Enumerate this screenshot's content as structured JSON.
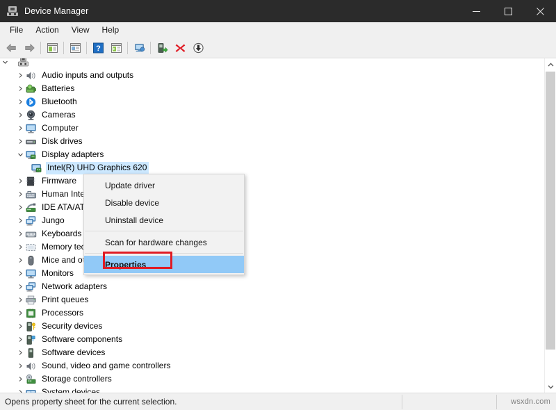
{
  "window": {
    "title": "Device Manager",
    "icon": "device-manager-icon",
    "controls": {
      "minimize": "minimize-icon",
      "maximize": "maximize-icon",
      "close": "close-icon"
    }
  },
  "menubar": {
    "items": [
      {
        "label": "File"
      },
      {
        "label": "Action"
      },
      {
        "label": "View"
      },
      {
        "label": "Help"
      }
    ]
  },
  "toolbar": {
    "buttons": [
      {
        "name": "back-icon",
        "tip": "Back"
      },
      {
        "name": "forward-icon",
        "tip": "Forward"
      },
      {
        "name": "show-hide-console-tree-icon",
        "tip": "Show/Hide Console Tree"
      },
      {
        "name": "properties-icon",
        "tip": "Properties"
      },
      {
        "name": "help-icon",
        "tip": "Help"
      },
      {
        "name": "update-driver-icon",
        "tip": "Update driver"
      },
      {
        "name": "scan-for-hardware-changes-icon",
        "tip": "Scan for hardware changes"
      },
      {
        "name": "enable-device-icon",
        "tip": "Enable device"
      },
      {
        "name": "uninstall-device-icon",
        "tip": "Uninstall device"
      },
      {
        "name": "disable-device-icon",
        "tip": "Disable device"
      }
    ]
  },
  "tree": {
    "root": {
      "label": "",
      "icon": "computer-root-icon",
      "expanded": true
    },
    "items": [
      {
        "label": "Audio inputs and outputs",
        "icon": "speaker-icon",
        "expanded": false,
        "indent": 1
      },
      {
        "label": "Batteries",
        "icon": "battery-icon",
        "expanded": false,
        "indent": 1
      },
      {
        "label": "Bluetooth",
        "icon": "bluetooth-icon",
        "expanded": false,
        "indent": 1
      },
      {
        "label": "Cameras",
        "icon": "camera-icon",
        "expanded": false,
        "indent": 1
      },
      {
        "label": "Computer",
        "icon": "monitor-icon",
        "expanded": false,
        "indent": 1
      },
      {
        "label": "Disk drives",
        "icon": "disk-drive-icon",
        "expanded": false,
        "indent": 1
      },
      {
        "label": "Display adapters",
        "icon": "display-adapter-icon",
        "expanded": true,
        "indent": 1
      },
      {
        "label": "Intel(R) UHD Graphics 620",
        "icon": "display-adapter-icon",
        "expanded": null,
        "indent": 2,
        "selected": true
      },
      {
        "label": "Firmware",
        "icon": "firmware-icon",
        "expanded": false,
        "indent": 1
      },
      {
        "label": "Human Interface Devices",
        "icon": "hid-icon",
        "expanded": false,
        "indent": 1
      },
      {
        "label": "IDE ATA/ATAPI controllers",
        "icon": "ide-controller-icon",
        "expanded": false,
        "indent": 1
      },
      {
        "label": "Jungo",
        "icon": "network-adapter-icon",
        "expanded": false,
        "indent": 1
      },
      {
        "label": "Keyboards",
        "icon": "keyboard-icon",
        "expanded": false,
        "indent": 1
      },
      {
        "label": "Memory technology devices",
        "icon": "memory-icon",
        "expanded": false,
        "indent": 1
      },
      {
        "label": "Mice and other pointing devices",
        "icon": "mouse-icon",
        "expanded": false,
        "indent": 1
      },
      {
        "label": "Monitors",
        "icon": "monitor-icon",
        "expanded": false,
        "indent": 1
      },
      {
        "label": "Network adapters",
        "icon": "network-adapter-icon",
        "expanded": false,
        "indent": 1
      },
      {
        "label": "Print queues",
        "icon": "printer-icon",
        "expanded": false,
        "indent": 1
      },
      {
        "label": "Processors",
        "icon": "processor-icon",
        "expanded": false,
        "indent": 1
      },
      {
        "label": "Security devices",
        "icon": "security-device-icon",
        "expanded": false,
        "indent": 1
      },
      {
        "label": "Software components",
        "icon": "software-component-icon",
        "expanded": false,
        "indent": 1
      },
      {
        "label": "Software devices",
        "icon": "software-device-icon",
        "expanded": false,
        "indent": 1
      },
      {
        "label": "Sound, video and game controllers",
        "icon": "speaker-icon",
        "expanded": false,
        "indent": 1
      },
      {
        "label": "Storage controllers",
        "icon": "storage-controller-icon",
        "expanded": false,
        "indent": 1
      },
      {
        "label": "System devices",
        "icon": "system-device-icon",
        "expanded": false,
        "indent": 1
      }
    ]
  },
  "context_menu": {
    "items": [
      {
        "label": "Update driver",
        "highlighted": false
      },
      {
        "label": "Disable device",
        "highlighted": false
      },
      {
        "label": "Uninstall device",
        "highlighted": false
      },
      {
        "separator": true
      },
      {
        "label": "Scan for hardware changes",
        "highlighted": false
      },
      {
        "separator": true
      },
      {
        "label": "Properties",
        "highlighted": true
      }
    ],
    "annotation": {
      "target": "Properties",
      "color": "#e01b24"
    }
  },
  "statusbar": {
    "text": "Opens property sheet for the current selection.",
    "watermark": "wsxdn.com"
  },
  "colors": {
    "titlebar_bg": "#2b2b2b",
    "chrome_bg": "#f0f0f0",
    "selection_blue": "#cce8ff",
    "menu_highlight": "#91c9f7",
    "annotation_red": "#e01b24"
  }
}
